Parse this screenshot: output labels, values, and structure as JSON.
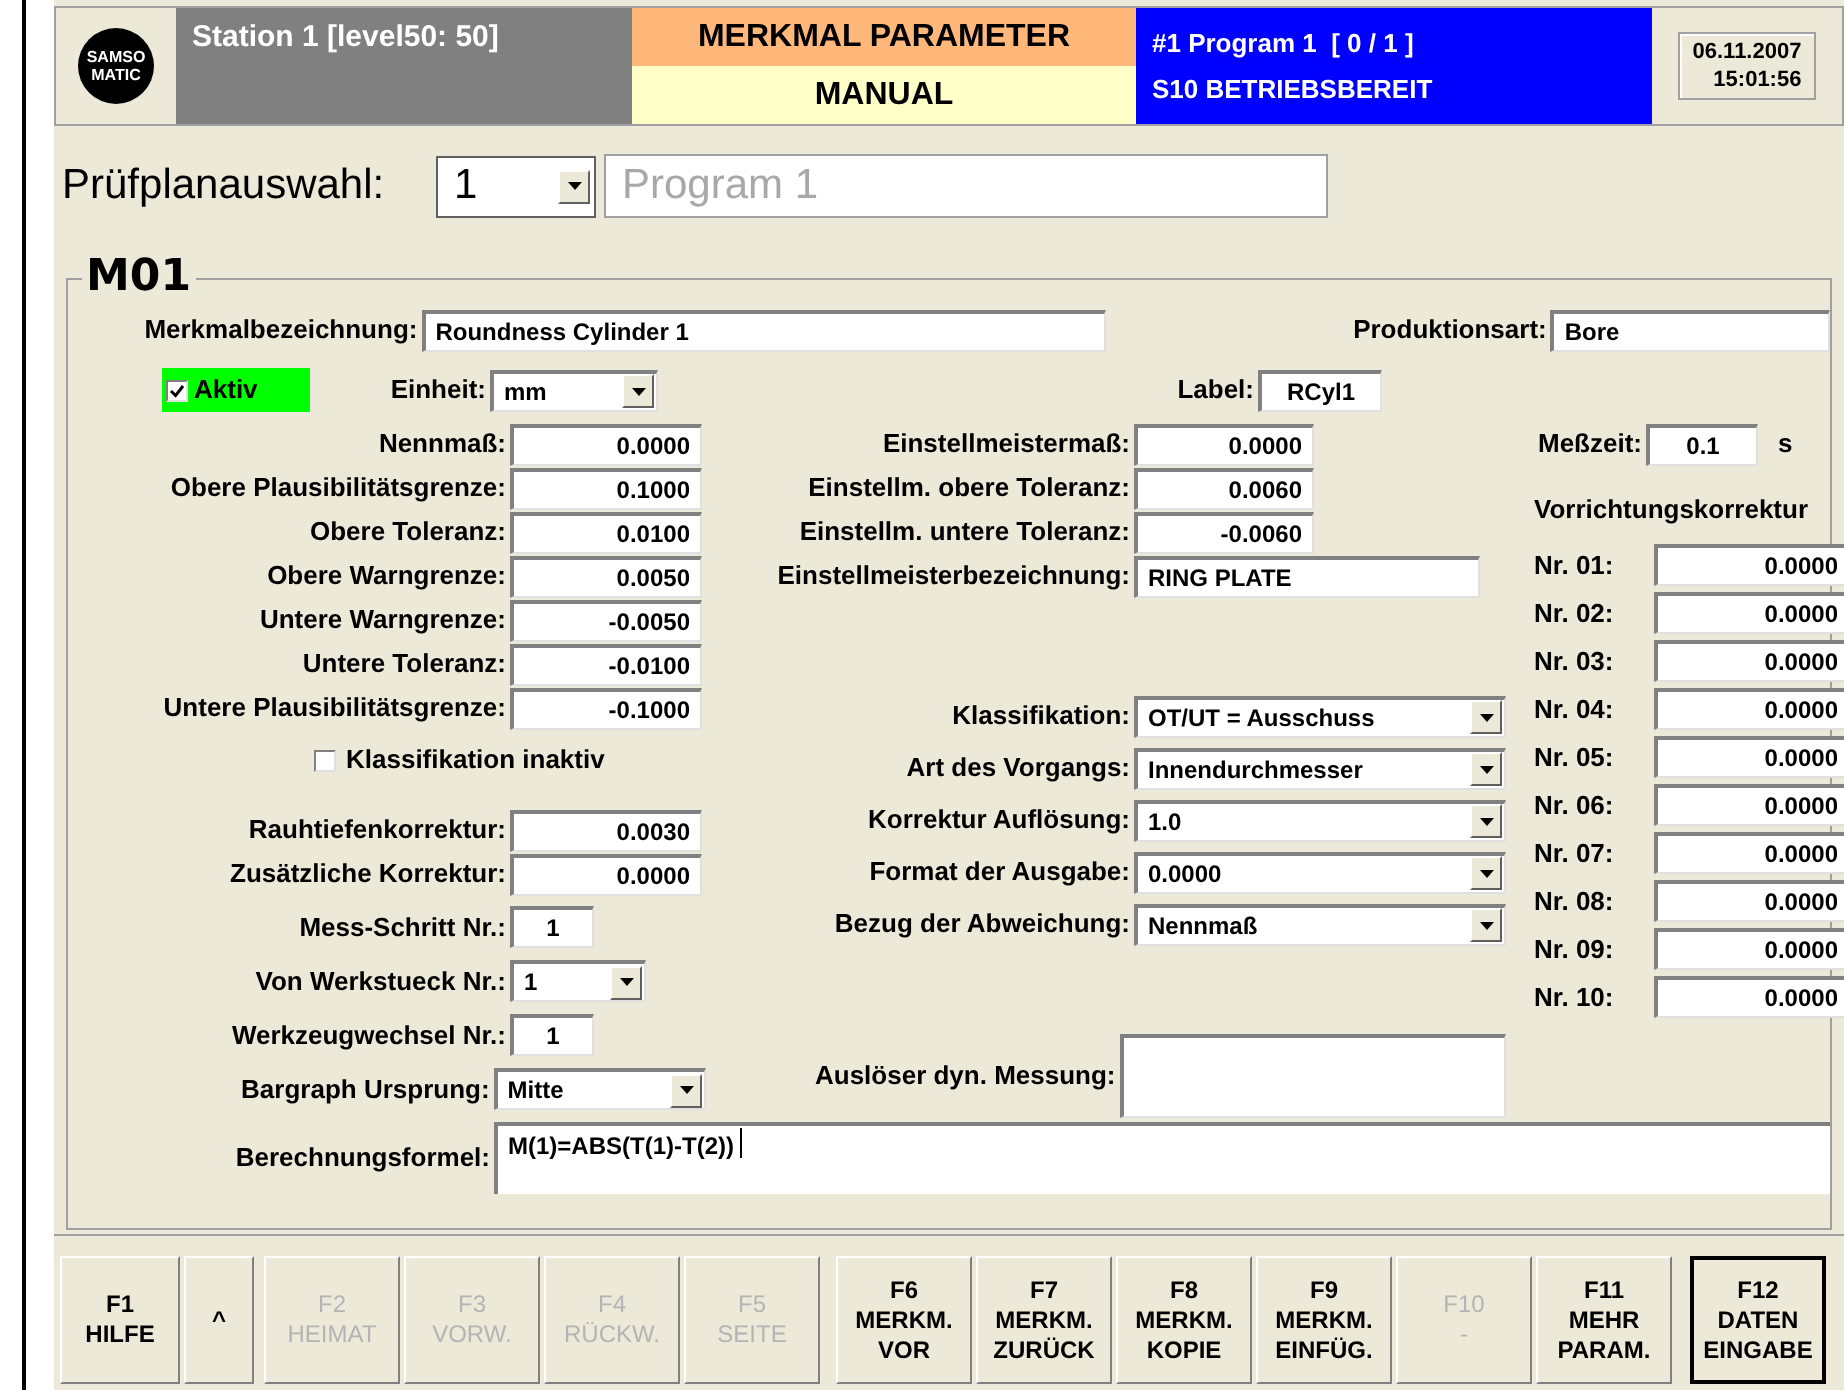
{
  "header": {
    "logo_text": [
      "SAMSO",
      "MATIC"
    ],
    "station": "Station 1 [level50: 50]",
    "screen_title": "MERKMAL PARAMETER",
    "mode": "MANUAL",
    "program": "#1 Program 1  [ 0 / 1 ]",
    "status": "S10 BETRIEBSBEREIT",
    "date": "06.11.2007",
    "time": "15:01:56"
  },
  "plan": {
    "label": "Prüfplanauswahl:",
    "number": "1",
    "name": "Program 1"
  },
  "group": {
    "title": "M01",
    "merkmal": {
      "label": "Merkmalbezeichnung:",
      "value": "Roundness Cylinder 1"
    },
    "produktionsart": {
      "label": "Produktionsart:",
      "value": "Bore"
    },
    "aktiv": {
      "label": "Aktiv",
      "checked": true
    },
    "einheit": {
      "label": "Einheit:",
      "value": "mm"
    },
    "label_field": {
      "label": "Label:",
      "value": "RCyl1"
    },
    "limits": [
      {
        "label": "Nennmaß:",
        "value": "0.0000"
      },
      {
        "label": "Obere Plausibilitätsgrenze:",
        "value": "0.1000"
      },
      {
        "label": "Obere Toleranz:",
        "value": "0.0100"
      },
      {
        "label": "Obere Warngrenze:",
        "value": "0.0050"
      },
      {
        "label": "Untere Warngrenze:",
        "value": "-0.0050"
      },
      {
        "label": "Untere Toleranz:",
        "value": "-0.0100"
      },
      {
        "label": "Untere Plausibilitätsgrenze:",
        "value": "-0.1000"
      }
    ],
    "klassifikation_inaktiv": {
      "label": "Klassifikation inaktiv",
      "checked": false
    },
    "corrections": [
      {
        "label": "Rauhtiefenkorrektur:",
        "value": "0.0030"
      },
      {
        "label": "Zusätzliche Korrektur:",
        "value": "0.0000"
      }
    ],
    "misc": [
      {
        "label": "Mess-Schritt Nr.:",
        "value": "1",
        "kind": "short"
      },
      {
        "label": "Von Werkstueck Nr.:",
        "value": "1",
        "kind": "select"
      },
      {
        "label": "Werkzeugwechsel Nr.:",
        "value": "1",
        "kind": "short"
      },
      {
        "label": "Bargraph Ursprung:",
        "value": "Mitte",
        "kind": "select"
      }
    ],
    "einstell": [
      {
        "label": "Einstellmeistermaß:",
        "value": "0.0000",
        "kind": "number"
      },
      {
        "label": "Einstellm. obere Toleranz:",
        "value": "0.0060",
        "kind": "number"
      },
      {
        "label": "Einstellm. untere Toleranz:",
        "value": "-0.0060",
        "kind": "number"
      },
      {
        "label": "Einstellmeisterbezeichnung:",
        "value": "RING PLATE",
        "kind": "text"
      }
    ],
    "selects": [
      {
        "label": "Klassifikation:",
        "value": "OT/UT = Ausschuss"
      },
      {
        "label": "Art des Vorgangs:",
        "value": "Innendurchmesser"
      },
      {
        "label": "Korrektur Auflösung:",
        "value": "1.0"
      },
      {
        "label": "Format der Ausgabe:",
        "value": "0.0000"
      },
      {
        "label": "Bezug der Abweichung:",
        "value": "Nennmaß"
      }
    ],
    "ausloeser": {
      "label": "Auslöser dyn. Messung:"
    },
    "messzeit": {
      "label": "Meßzeit:",
      "value": "0.1",
      "unit": "s"
    },
    "vorrichtung": {
      "title": "Vorrichtungskorrektur",
      "items": [
        {
          "label": "Nr. 01:",
          "value": "0.0000"
        },
        {
          "label": "Nr. 02:",
          "value": "0.0000"
        },
        {
          "label": "Nr. 03:",
          "value": "0.0000"
        },
        {
          "label": "Nr. 04:",
          "value": "0.0000"
        },
        {
          "label": "Nr. 05:",
          "value": "0.0000"
        },
        {
          "label": "Nr. 06:",
          "value": "0.0000"
        },
        {
          "label": "Nr. 07:",
          "value": "0.0000"
        },
        {
          "label": "Nr. 08:",
          "value": "0.0000"
        },
        {
          "label": "Nr. 09:",
          "value": "0.0000"
        },
        {
          "label": "Nr. 10:",
          "value": "0.0000"
        }
      ]
    },
    "formula": {
      "label": "Berechnungsformel:",
      "value": "M(1)=ABS(T(1)-T(2))"
    }
  },
  "function_keys": [
    {
      "key": "F1",
      "label": [
        "HILFE"
      ],
      "disabled": false,
      "focused": false
    },
    {
      "key": "^",
      "disabled": false,
      "focused": false
    },
    {
      "key": "F2",
      "label": [
        "HEIMAT"
      ],
      "disabled": true,
      "focused": false
    },
    {
      "key": "F3",
      "label": [
        "VORW."
      ],
      "disabled": true,
      "focused": false
    },
    {
      "key": "F4",
      "label": [
        "RÜCKW."
      ],
      "disabled": true,
      "focused": false
    },
    {
      "key": "F5",
      "label": [
        "SEITE"
      ],
      "disabled": true,
      "focused": false
    },
    {
      "key": "F6",
      "label": [
        "MERKM.",
        "VOR"
      ],
      "disabled": false,
      "focused": false
    },
    {
      "key": "F7",
      "label": [
        "MERKM.",
        "ZURÜCK"
      ],
      "disabled": false,
      "focused": false
    },
    {
      "key": "F8",
      "label": [
        "MERKM.",
        "KOPIE"
      ],
      "disabled": false,
      "focused": false
    },
    {
      "key": "F9",
      "label": [
        "MERKM.",
        "EINFÜG."
      ],
      "disabled": false,
      "focused": false
    },
    {
      "key": "F10",
      "label": [
        "-"
      ],
      "disabled": true,
      "focused": false
    },
    {
      "key": "F11",
      "label": [
        "MEHR",
        "PARAM."
      ],
      "disabled": false,
      "focused": false
    },
    {
      "key": "F12",
      "label": [
        "DATEN",
        "EINGABE"
      ],
      "disabled": false,
      "focused": true
    }
  ]
}
